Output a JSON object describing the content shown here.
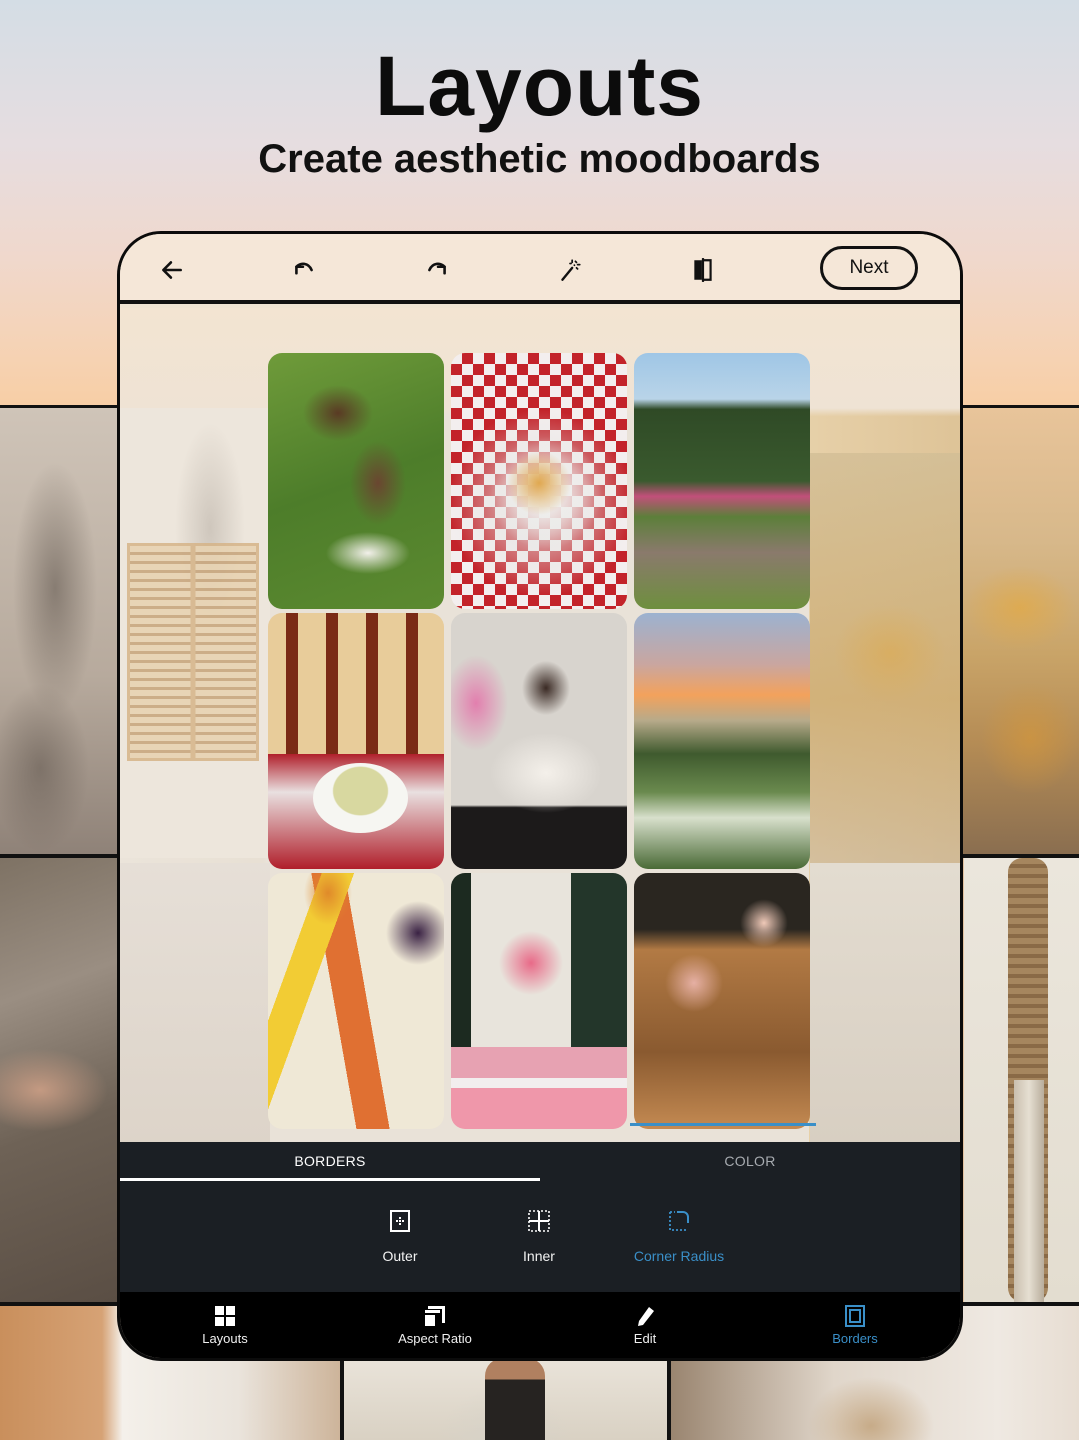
{
  "header": {
    "title": "Layouts",
    "subtitle": "Create aesthetic moodboards"
  },
  "toolbar": {
    "icons": [
      "back-arrow-icon",
      "undo-icon",
      "redo-icon",
      "magic-wand-icon",
      "compare-icon"
    ],
    "next_label": "Next"
  },
  "collage": {
    "tiles": [
      {
        "name": "boxer-dog-on-grass"
      },
      {
        "name": "french-onion-soup"
      },
      {
        "name": "garden-path-walker"
      },
      {
        "name": "matcha-latte-chair"
      },
      {
        "name": "fairy-wings-portrait"
      },
      {
        "name": "sunset-hydrangeas"
      },
      {
        "name": "corn-carrots-pies"
      },
      {
        "name": "pink-flower-window"
      },
      {
        "name": "cocktails-on-table"
      }
    ]
  },
  "border_panel": {
    "tabs": [
      {
        "label": "BORDERS",
        "active": true
      },
      {
        "label": "COLOR",
        "active": false
      }
    ],
    "options": [
      {
        "label": "Outer",
        "icon": "outer-border-icon",
        "selected": false
      },
      {
        "label": "Inner",
        "icon": "inner-border-icon",
        "selected": false
      },
      {
        "label": "Corner Radius",
        "icon": "corner-radius-icon",
        "selected": true
      }
    ]
  },
  "bottom_nav": {
    "items": [
      {
        "label": "Layouts",
        "icon": "layouts-icon",
        "active": false
      },
      {
        "label": "Aspect Ratio",
        "icon": "aspect-ratio-icon",
        "active": false
      },
      {
        "label": "Edit",
        "icon": "pencil-icon",
        "active": false
      },
      {
        "label": "Borders",
        "icon": "borders-icon",
        "active": true
      }
    ]
  },
  "colors": {
    "accent": "#3a8fc8",
    "panel_bg": "#1b1f24",
    "nav_bg": "#000000",
    "toolbar_bg": "#f5e7d8"
  }
}
